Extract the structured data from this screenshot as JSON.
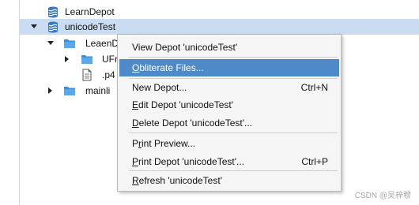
{
  "tree": {
    "items": [
      {
        "label": "LearnDepot"
      },
      {
        "label": "unicodeTest"
      },
      {
        "label": "LeaenDepot"
      },
      {
        "label": "UFr"
      },
      {
        "label": ".p4"
      },
      {
        "label": "mainli"
      }
    ]
  },
  "menu": {
    "items": [
      {
        "label": "View Depot 'unicodeTest'",
        "shortcut": ""
      },
      {
        "label_access": "O",
        "label_rest": "bliterate Files...",
        "shortcut": ""
      },
      {
        "label": "New Depot...",
        "shortcut": "Ctrl+N"
      },
      {
        "label_access": "E",
        "label_rest": "dit Depot 'unicodeTest'",
        "shortcut": ""
      },
      {
        "label_access": "D",
        "label_rest": "elete Depot 'unicodeTest'...",
        "shortcut": ""
      },
      {
        "label_pre": "P",
        "label_access": "r",
        "label_rest": "int Preview...",
        "shortcut": ""
      },
      {
        "label_access": "P",
        "label_rest": "rint Depot 'unicodeTest'...",
        "shortcut": "Ctrl+P"
      },
      {
        "label_access": "R",
        "label_rest": "efresh 'unicodeTest'",
        "shortcut": ""
      }
    ]
  },
  "watermark": "CSDN @吴梓穆",
  "colors": {
    "selection": "#c9dcf1",
    "menu_hover": "#4e8ac9",
    "depot_icon": "#3a78c2",
    "folder_icon": "#3a8fd8"
  }
}
